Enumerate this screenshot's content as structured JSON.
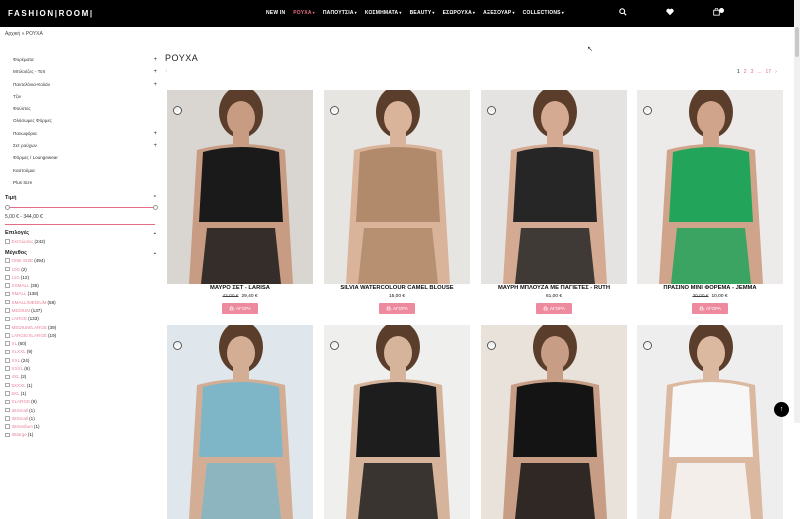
{
  "header": {
    "logo": "FASHION|ROOM|",
    "nav": [
      {
        "label": "NEW IN",
        "has_menu": false,
        "active": false
      },
      {
        "label": "ΡΟΥΧΑ",
        "has_menu": true,
        "active": true
      },
      {
        "label": "ΠΑΠΟΥΤΣΙΑ",
        "has_menu": true,
        "active": false
      },
      {
        "label": "ΚΟΣΜΗΜΑΤΑ",
        "has_menu": true,
        "active": false
      },
      {
        "label": "BEAUTY",
        "has_menu": true,
        "active": false
      },
      {
        "label": "ΕΣΩΡΟΥΧΑ",
        "has_menu": true,
        "active": false
      },
      {
        "label": "ΑΞΕΣΟΥΑΡ",
        "has_menu": true,
        "active": false
      },
      {
        "label": "COLLECTIONS",
        "has_menu": true,
        "active": false
      }
    ],
    "icons": {
      "search": "search-icon",
      "wishlist": "heart-icon",
      "cart": "bag-icon"
    }
  },
  "breadcrumb": {
    "home": "Αρχική",
    "sep": "»",
    "current": "ΡΟΥΧΑ"
  },
  "sidebar": {
    "categories": [
      {
        "label": "Φορέματα",
        "expandable": true
      },
      {
        "label": "Μπλούζες - Τοπ",
        "expandable": true
      },
      {
        "label": "Παντελόνια-Κολάν",
        "expandable": true
      },
      {
        "label": "Τζιν",
        "expandable": false
      },
      {
        "label": "Φούστες",
        "expandable": false
      },
      {
        "label": "Ολόσωμες Φόρμες",
        "expandable": false
      },
      {
        "label": "Πανωφόρια",
        "expandable": true
      },
      {
        "label": "Σετ ρούχων",
        "expandable": true
      },
      {
        "label": "Φόρμες / Loungewear",
        "expandable": false
      },
      {
        "label": "Καστούμια",
        "expandable": false
      },
      {
        "label": "Plus Size",
        "expandable": false
      }
    ],
    "price": {
      "title": "Τιμή",
      "range": "5,00 € - 344,00 €",
      "min": 5,
      "max": 344
    },
    "options": {
      "title": "Επιλογές",
      "items": [
        {
          "label": "Εκπτώσεις",
          "count": "(242)"
        }
      ]
    },
    "sizes": {
      "title": "Μέγεθος",
      "items": [
        {
          "label": "ONE-SIZE",
          "count": "(494)"
        },
        {
          "label": "10G",
          "count": "(2)"
        },
        {
          "label": "11G",
          "count": "(12)"
        },
        {
          "label": "XSMALL",
          "count": "(35)"
        },
        {
          "label": "SMALL",
          "count": "(138)"
        },
        {
          "label": "SMALL/MEDIUM",
          "count": "(58)"
        },
        {
          "label": "MEDIUM",
          "count": "(137)"
        },
        {
          "label": "LARGE",
          "count": "(133)"
        },
        {
          "label": "MEDIUM/LARGE",
          "count": "(39)"
        },
        {
          "label": "LARGE/XLARGE",
          "count": "(19)"
        },
        {
          "label": "XL",
          "count": "(60)"
        },
        {
          "label": "XLXXL",
          "count": "(9)"
        },
        {
          "label": "XXL",
          "count": "(24)"
        },
        {
          "label": "XXXL",
          "count": "(6)"
        },
        {
          "label": "4XL",
          "count": "(2)"
        },
        {
          "label": "5XXXL",
          "count": "(1)"
        },
        {
          "label": "6XL",
          "count": "(1)"
        },
        {
          "label": "XLARGE",
          "count": "(9)"
        },
        {
          "label": "36Small",
          "count": "(1)"
        },
        {
          "label": "38Small",
          "count": "(1)"
        },
        {
          "label": "38medium",
          "count": "(1)"
        },
        {
          "label": "38large",
          "count": "(1)"
        }
      ]
    }
  },
  "main": {
    "title": "ΡΟΥΧΑ",
    "subtitle_dot": "↑",
    "pagination": [
      "1",
      "2",
      "3",
      "...",
      "17",
      "›"
    ],
    "current_page": "1",
    "buy_label": "ΑΓΟΡΑ",
    "products": [
      {
        "name": "ΜΑΥΡΟ ΣΕΤ - LARISA",
        "old_price": "42,00 €",
        "price": "29,40 €",
        "bg": "#d9d6d2",
        "main": "#1a1a1a",
        "skin": "#c89c82"
      },
      {
        "name": "SILVIA WATERCOLOUR CAMEL BLOUSE",
        "old_price": "",
        "price": "15,00 €",
        "bg": "#e7e5e2",
        "main": "#b08a6a",
        "skin": "#d9b39a"
      },
      {
        "name": "ΜΑΥΡΗ ΜΠΛΟΥΖΑ ΜΕ ΠΑΓΙΕΤΕΣ - RUTH",
        "old_price": "",
        "price": "61,00 €",
        "bg": "#e4e3e1",
        "main": "#262626",
        "skin": "#d4ab92"
      },
      {
        "name": "ΠΡΑΣΙΝΟ ΜΙΝΙ ΦΟΡΕΜΑ - JEMMA",
        "old_price": "30,00 €",
        "price": "10,00 €",
        "bg": "#ecebea",
        "main": "#22a55a",
        "skin": "#cfa48a"
      },
      {
        "name": "",
        "old_price": "",
        "price": "",
        "bg": "#dfe6ec",
        "main": "#7fb6c7",
        "skin": "#d3ae95"
      },
      {
        "name": "",
        "old_price": "",
        "price": "",
        "bg": "#efefee",
        "main": "#1d1d1d",
        "skin": "#d6b49c"
      },
      {
        "name": "",
        "old_price": "",
        "price": "",
        "bg": "#e9e2da",
        "main": "#141414",
        "skin": "#c79d85"
      },
      {
        "name": "",
        "old_price": "",
        "price": "",
        "bg": "#eeeeee",
        "main": "#f7f7f7",
        "skin": "#dbb8a0"
      }
    ]
  },
  "accent_color": "#e66b87"
}
